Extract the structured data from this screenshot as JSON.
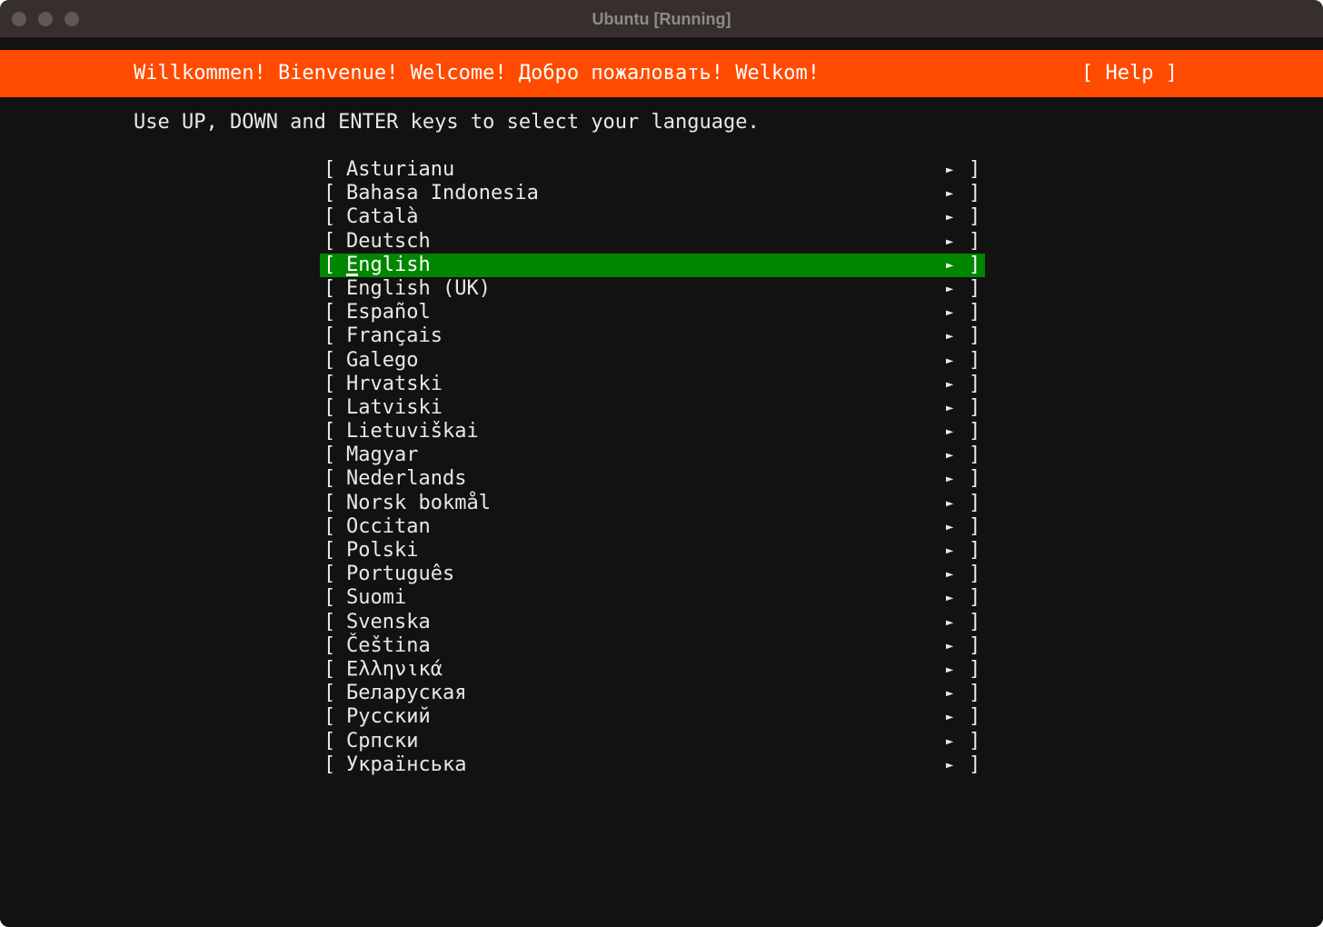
{
  "window": {
    "title": "Ubuntu [Running]"
  },
  "header": {
    "welcome": "Willkommen! Bienvenue! Welcome! Добро пожаловать! Welkom!",
    "help_label": "[ Help ]"
  },
  "instructions": "Use UP, DOWN and ENTER keys to select your language.",
  "languages": {
    "selected_index": 4,
    "bracket_open": "[",
    "bracket_close": "]",
    "arrow": "►",
    "items": [
      "Asturianu",
      "Bahasa Indonesia",
      "Català",
      "Deutsch",
      "English",
      "English (UK)",
      "Español",
      "Français",
      "Galego",
      "Hrvatski",
      "Latviski",
      "Lietuviškai",
      "Magyar",
      "Nederlands",
      "Norsk bokmål",
      "Occitan",
      "Polski",
      "Português",
      "Suomi",
      "Svenska",
      "Čeština",
      "Ελληνικά",
      "Беларуская",
      "Русский",
      "Српски",
      "Українська"
    ]
  },
  "colors": {
    "header_bg": "#ff4b00",
    "selected_bg": "#008700",
    "screen_bg": "#121212",
    "titlebar_bg": "#362f2e"
  }
}
